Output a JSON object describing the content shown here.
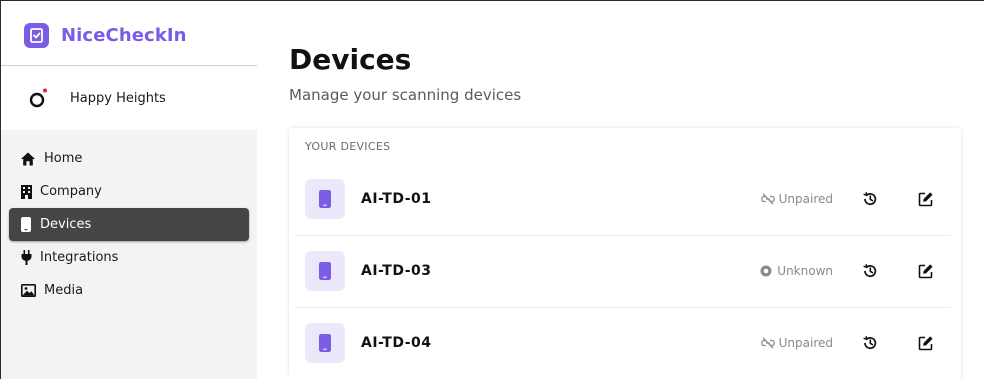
{
  "app": {
    "name": "NiceCheckIn",
    "brand_color": "#7b5ce6"
  },
  "organization": {
    "name": "Happy Heights",
    "logo_icon": "happy-heights-logo-icon"
  },
  "sidebar": {
    "items": [
      {
        "label": "Home",
        "icon": "home-icon",
        "active": false
      },
      {
        "label": "Company",
        "icon": "building-icon",
        "active": false
      },
      {
        "label": "Devices",
        "icon": "phone-icon",
        "active": true
      },
      {
        "label": "Integrations",
        "icon": "plug-icon",
        "active": false
      },
      {
        "label": "Media",
        "icon": "image-icon",
        "active": false
      }
    ]
  },
  "page": {
    "title": "Devices",
    "subtitle": "Manage your scanning devices"
  },
  "devices_section": {
    "label": "YOUR DEVICES",
    "devices": [
      {
        "name": "AI-TD-01",
        "status": "Unpaired",
        "status_icon": "unlink-icon"
      },
      {
        "name": "AI-TD-03",
        "status": "Unknown",
        "status_icon": "unknown-status-dot-icon"
      },
      {
        "name": "AI-TD-04",
        "status": "Unpaired",
        "status_icon": "unlink-icon"
      }
    ]
  },
  "colors": {
    "active_nav_bg": "#454545",
    "device_icon_bg": "#ece8fb",
    "device_icon_fg": "#7b5ce6"
  }
}
